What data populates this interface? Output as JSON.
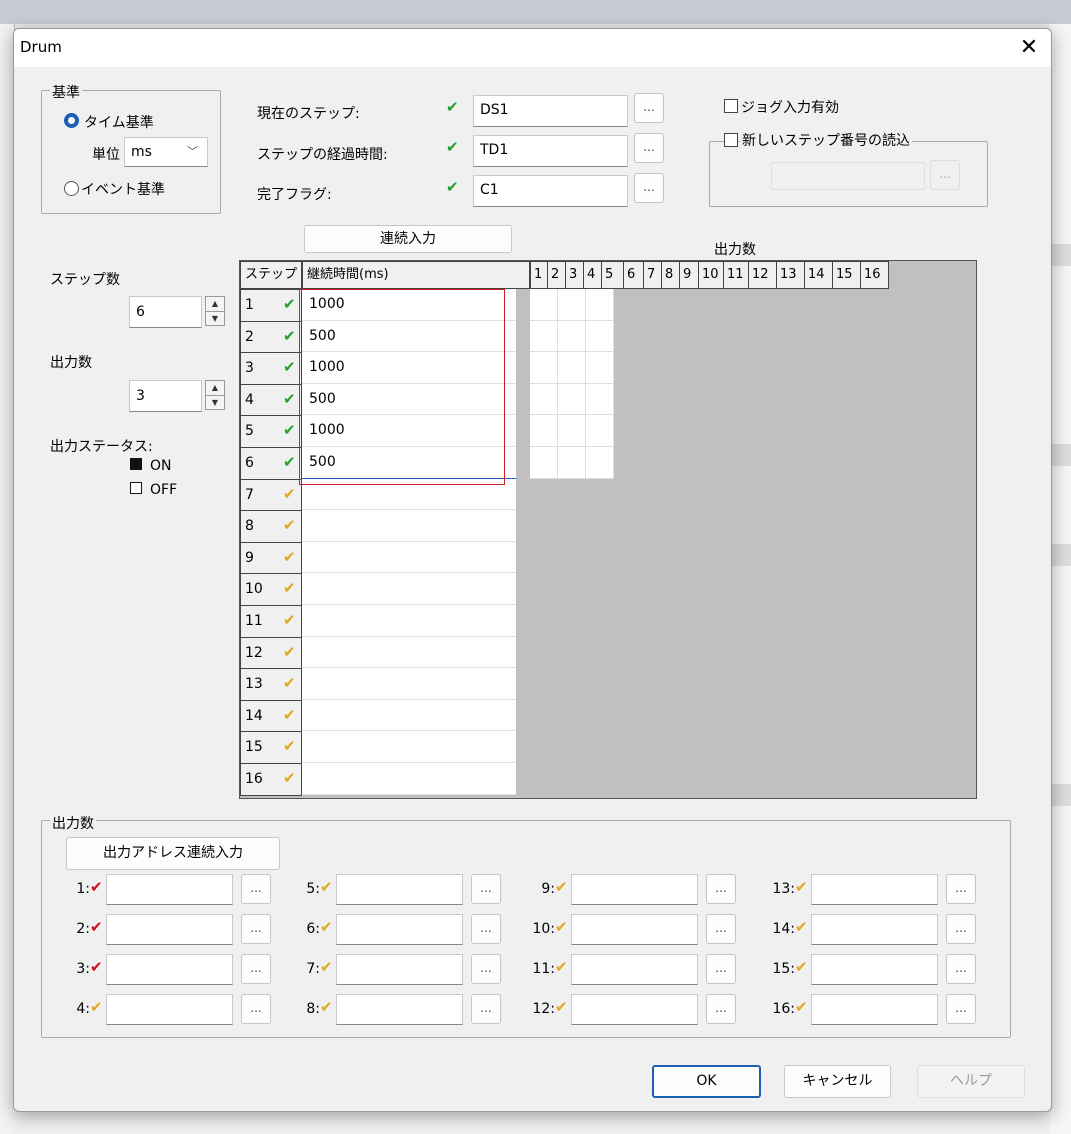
{
  "window": {
    "title": "Drum"
  },
  "basis": {
    "group_label": "基準",
    "time_basis_label": "タイム基準",
    "unit_label": "単位",
    "unit_value": "ms",
    "event_basis_label": "イベント基準",
    "selected": "time"
  },
  "fields": {
    "current_step_label": "現在のステップ:",
    "current_step_value": "DS1",
    "elapsed_label": "ステップの経過時間:",
    "elapsed_value": "TD1",
    "done_flag_label": "完了フラグ:",
    "done_flag_value": "C1",
    "browse_label": "..."
  },
  "jog": {
    "jog_label": "ジョグ入力有効",
    "new_step_label": "新しいステップ番号の読込",
    "browse_label": "..."
  },
  "left": {
    "step_count_label": "ステップ数",
    "step_count_value": "6",
    "output_count_label": "出力数",
    "output_count_value": "3",
    "output_status_label": "出力ステータス:",
    "on_label": "ON",
    "off_label": "OFF"
  },
  "grid": {
    "continuous_input_label": "連続入力",
    "outputs_title": "出力数",
    "step_header": "ステップ",
    "duration_header": "継続時間(ms)",
    "output_headers": [
      "1",
      "2",
      "3",
      "4",
      "5",
      "6",
      "7",
      "8",
      "9",
      "10",
      "11",
      "12",
      "13",
      "14",
      "15",
      "16"
    ],
    "rows": [
      {
        "step": "1",
        "duration": "1000",
        "status": "green"
      },
      {
        "step": "2",
        "duration": "500",
        "status": "green"
      },
      {
        "step": "3",
        "duration": "1000",
        "status": "green"
      },
      {
        "step": "4",
        "duration": "500",
        "status": "green"
      },
      {
        "step": "5",
        "duration": "1000",
        "status": "green"
      },
      {
        "step": "6",
        "duration": "500",
        "status": "green"
      },
      {
        "step": "7",
        "duration": "",
        "status": "yellow"
      },
      {
        "step": "8",
        "duration": "",
        "status": "yellow"
      },
      {
        "step": "9",
        "duration": "",
        "status": "yellow"
      },
      {
        "step": "10",
        "duration": "",
        "status": "yellow"
      },
      {
        "step": "11",
        "duration": "",
        "status": "yellow"
      },
      {
        "step": "12",
        "duration": "",
        "status": "yellow"
      },
      {
        "step": "13",
        "duration": "",
        "status": "yellow"
      },
      {
        "step": "14",
        "duration": "",
        "status": "yellow"
      },
      {
        "step": "15",
        "duration": "",
        "status": "yellow"
      },
      {
        "step": "16",
        "duration": "",
        "status": "yellow"
      }
    ]
  },
  "outputs": {
    "group_label": "出力数",
    "continuous_address_label": "出力アドレス連続入力",
    "browse_label": "...",
    "items": [
      {
        "label": "1:",
        "status": "red"
      },
      {
        "label": "2:",
        "status": "red"
      },
      {
        "label": "3:",
        "status": "red"
      },
      {
        "label": "4:",
        "status": "yellow"
      },
      {
        "label": "5:",
        "status": "yellow"
      },
      {
        "label": "6:",
        "status": "yellow"
      },
      {
        "label": "7:",
        "status": "yellow"
      },
      {
        "label": "8:",
        "status": "yellow"
      },
      {
        "label": "9:",
        "status": "yellow"
      },
      {
        "label": "10:",
        "status": "yellow"
      },
      {
        "label": "11:",
        "status": "yellow"
      },
      {
        "label": "12:",
        "status": "yellow"
      },
      {
        "label": "13:",
        "status": "yellow"
      },
      {
        "label": "14:",
        "status": "yellow"
      },
      {
        "label": "15:",
        "status": "yellow"
      },
      {
        "label": "16:",
        "status": "yellow"
      }
    ]
  },
  "footer": {
    "ok_label": "OK",
    "cancel_label": "キャンセル",
    "help_label": "ヘルプ"
  },
  "colors": {
    "check_green": "#22a12c",
    "check_yellow": "#e0a81c",
    "check_red": "#c8101c",
    "highlight_red": "#d42020",
    "accent_blue": "#1b5fb6"
  }
}
